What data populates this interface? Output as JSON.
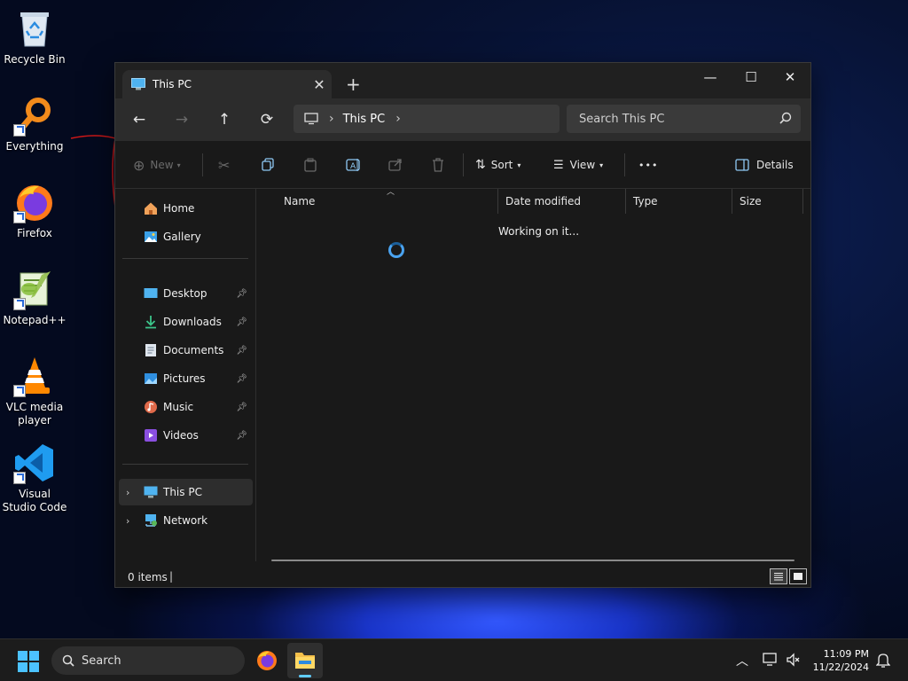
{
  "desktop": {
    "icons": [
      {
        "label": "Recycle Bin"
      },
      {
        "label": "Everything"
      },
      {
        "label": "Firefox"
      },
      {
        "label": "Notepad++"
      },
      {
        "label": "VLC media player"
      },
      {
        "label": "Visual Studio Code"
      }
    ]
  },
  "window": {
    "tab_title": "This PC",
    "tab_close": "✕",
    "new_tab": "+",
    "controls": {
      "minimize": "—",
      "maximize": "☐",
      "close": "✕"
    }
  },
  "navbar": {
    "breadcrumb": [
      "This PC"
    ],
    "search_placeholder": "Search This PC"
  },
  "toolbar": {
    "new_label": "New",
    "sort_label": "Sort",
    "view_label": "View",
    "more_label": "•••",
    "details_label": "Details"
  },
  "sidebar": {
    "quick": [
      {
        "label": "Home"
      },
      {
        "label": "Gallery"
      }
    ],
    "pinned": [
      {
        "label": "Desktop"
      },
      {
        "label": "Downloads"
      },
      {
        "label": "Documents"
      },
      {
        "label": "Pictures"
      },
      {
        "label": "Music"
      },
      {
        "label": "Videos"
      }
    ],
    "locations": [
      {
        "label": "This PC",
        "selected": true
      },
      {
        "label": "Network",
        "selected": false
      }
    ]
  },
  "content": {
    "columns": [
      "Name",
      "Date modified",
      "Type",
      "Size"
    ],
    "status_message": "Working on it..."
  },
  "statusbar": {
    "item_count": "0 items"
  },
  "taskbar": {
    "search_label": "Search",
    "time": "11:09 PM",
    "date": "11/22/2024"
  },
  "colors": {
    "accent": "#60cdff",
    "window_bg": "#191919",
    "spinner": "#4aa3f0"
  }
}
